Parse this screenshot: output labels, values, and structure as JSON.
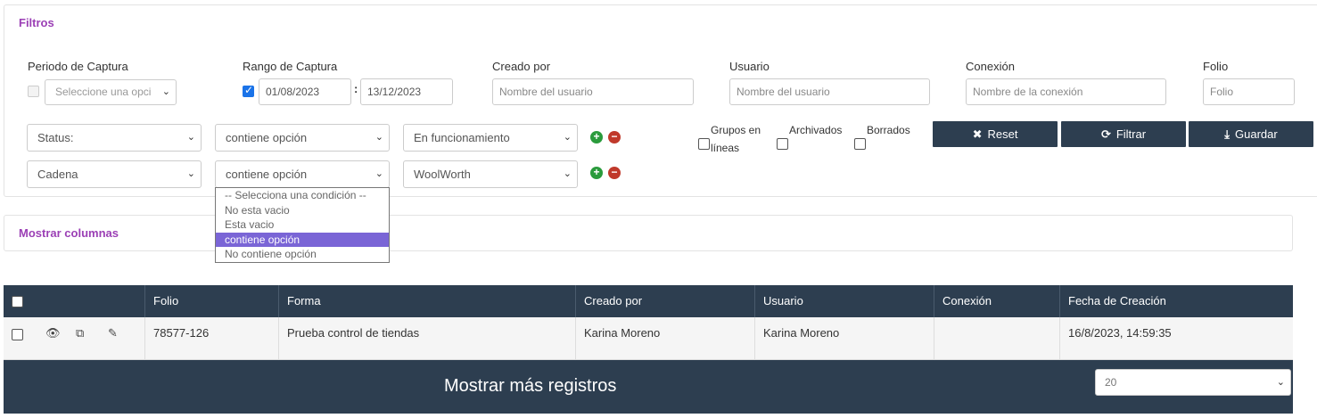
{
  "filters": {
    "title": "Filtros",
    "periodo_label": "Periodo de Captura",
    "periodo_select": "Seleccione una opci",
    "rango_label": "Rango de Captura",
    "rango_from": "01/08/2023",
    "rango_sep": ":",
    "rango_to": "13/12/2023",
    "creado_label": "Creado por",
    "creado_placeholder": "Nombre del usuario",
    "usuario_label": "Usuario",
    "usuario_placeholder": "Nombre del usuario",
    "conexion_label": "Conexión",
    "conexion_placeholder": "Nombre de la conexión",
    "folio_label": "Folio",
    "folio_placeholder": "Folio",
    "rows": [
      {
        "field": "Status:",
        "condition": "contiene opción",
        "value": "En funcionamiento"
      },
      {
        "field": "Cadena",
        "condition": "contiene opción",
        "value": "WoolWorth"
      }
    ],
    "grupos_label_1": "Grupos en",
    "grupos_label_2": "líneas",
    "archivados_label": "Archivados",
    "borrados_label": "Borrados",
    "reset_label": "Reset",
    "filtrar_label": "Filtrar",
    "guardar_label": "Guardar",
    "condition_options": [
      "-- Selecciona una condición --",
      "No esta vacio",
      "Esta vacio",
      "contiene opción",
      "No contiene opción"
    ],
    "condition_selected": "contiene opción"
  },
  "columns": {
    "title": "Mostrar columnas"
  },
  "table": {
    "headers": [
      "",
      "Folio",
      "Forma",
      "Creado por",
      "Usuario",
      "Conexión",
      "Fecha de Creación"
    ],
    "rows": [
      {
        "folio": "78577-126",
        "forma": "Prueba control de tiendas",
        "creado_por": "Karina Moreno",
        "usuario": "Karina Moreno",
        "conexion": "",
        "fecha": "16/8/2023, 14:59:35"
      }
    ]
  },
  "footer": {
    "more_label": "Mostrar más registros",
    "page_size": "20"
  },
  "colors": {
    "accent": "#9b3fb5",
    "header": "#2d3e50",
    "selected_option": "#7a65d6",
    "plus": "#2a9b3c",
    "minus": "#c0392b"
  }
}
